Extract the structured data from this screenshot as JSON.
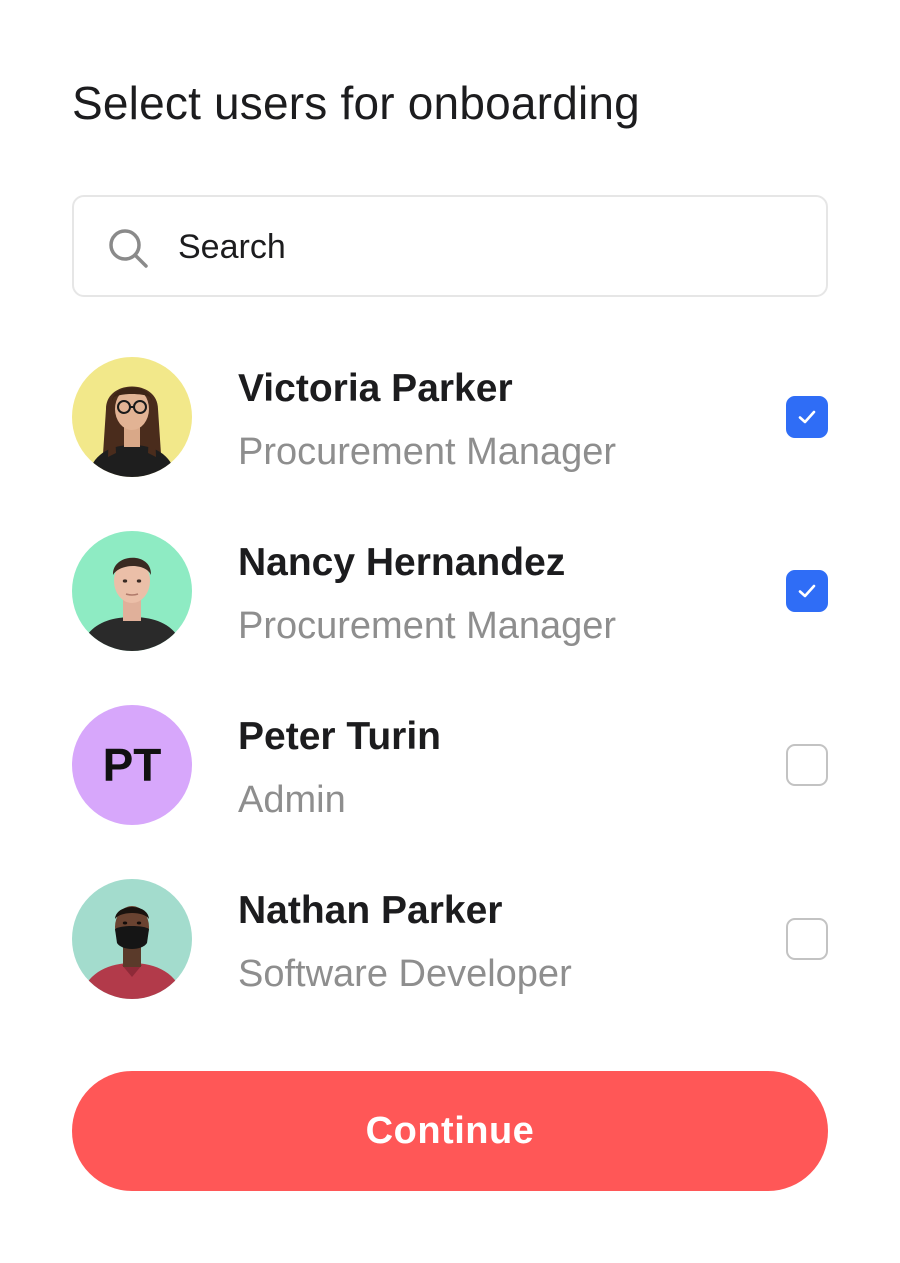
{
  "title": "Select users for onboarding",
  "search": {
    "placeholder": "Search",
    "icon": "search-icon"
  },
  "users": [
    {
      "name": "Victoria Parker",
      "role": "Procurement Manager",
      "avatar": "photo",
      "avatar_bg": "#f2e88a",
      "checked": true
    },
    {
      "name": "Nancy Hernandez",
      "role": "Procurement Manager",
      "avatar": "photo",
      "avatar_bg": "#8eebc3",
      "checked": true
    },
    {
      "name": "Peter Turin",
      "role": "Admin",
      "avatar": "initials",
      "initials": "PT",
      "avatar_bg": "#d7a7fb",
      "checked": false
    },
    {
      "name": "Nathan Parker",
      "role": "Software Developer",
      "avatar": "photo",
      "avatar_bg": "#a3dccd",
      "checked": false
    }
  ],
  "continue_label": "Continue",
  "colors": {
    "accent": "#2f6df6",
    "primary_button": "#ff5757",
    "secondary_text": "#8e8e8e"
  }
}
